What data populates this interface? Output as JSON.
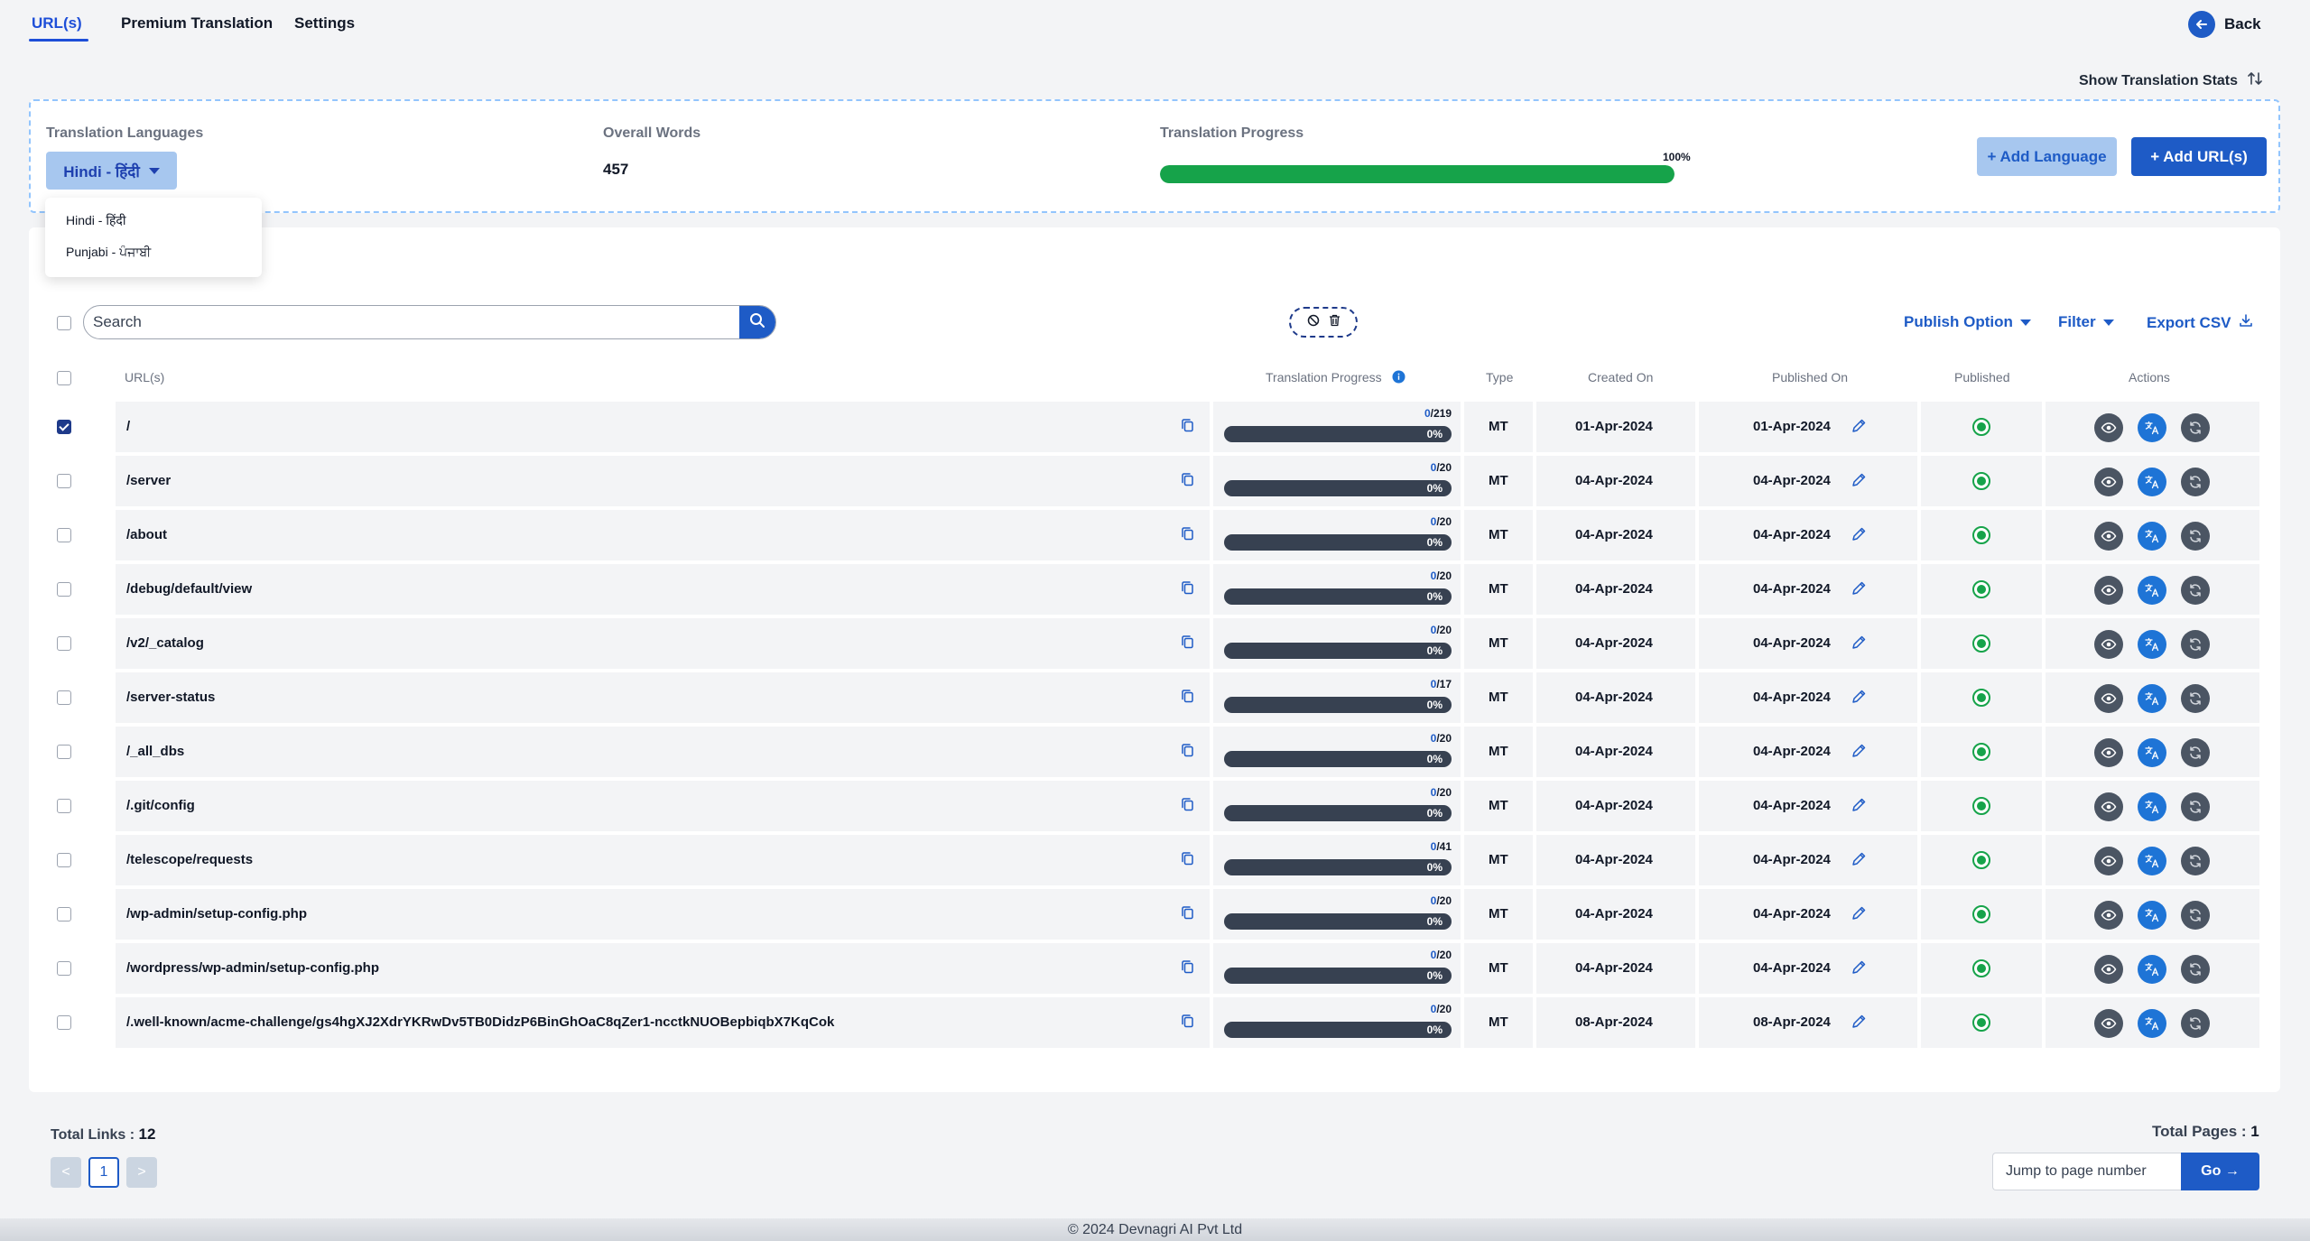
{
  "tabs": [
    {
      "label": "URL(s)"
    },
    {
      "label": "Premium Translation"
    },
    {
      "label": "Settings"
    }
  ],
  "back_label": "Back",
  "show_stats_label": "Show Translation Stats",
  "summary": {
    "languages_label": "Translation Languages",
    "selected_language": "Hindi - हिंदी",
    "overall_words_label": "Overall Words",
    "overall_words": "457",
    "progress_label": "Translation Progress",
    "progress_percent_text": "100%",
    "progress_value": 1.0,
    "add_language_label": "+ Add Language",
    "add_url_label": "+ Add URL(s)"
  },
  "language_options": [
    "Hindi - हिंदी",
    "Punjabi - ਪੰਜਾਬੀ"
  ],
  "search": {
    "placeholder": "Search"
  },
  "toolbar": {
    "publish_option": "Publish Option",
    "filter": "Filter",
    "export_csv": "Export CSV"
  },
  "table": {
    "headers": {
      "url": "URL(s)",
      "progress": "Translation Progress",
      "type": "Type",
      "created": "Created On",
      "published_on": "Published On",
      "published": "Published",
      "actions": "Actions"
    },
    "rows": [
      {
        "url": "/",
        "done": "0",
        "total": "/219",
        "pct": "0%",
        "type": "MT",
        "created": "01-Apr-2024",
        "published_on": "01-Apr-2024",
        "checked": true
      },
      {
        "url": "/server",
        "done": "0",
        "total": "/20",
        "pct": "0%",
        "type": "MT",
        "created": "04-Apr-2024",
        "published_on": "04-Apr-2024",
        "checked": false
      },
      {
        "url": "/about",
        "done": "0",
        "total": "/20",
        "pct": "0%",
        "type": "MT",
        "created": "04-Apr-2024",
        "published_on": "04-Apr-2024",
        "checked": false
      },
      {
        "url": "/debug/default/view",
        "done": "0",
        "total": "/20",
        "pct": "0%",
        "type": "MT",
        "created": "04-Apr-2024",
        "published_on": "04-Apr-2024",
        "checked": false
      },
      {
        "url": "/v2/_catalog",
        "done": "0",
        "total": "/20",
        "pct": "0%",
        "type": "MT",
        "created": "04-Apr-2024",
        "published_on": "04-Apr-2024",
        "checked": false
      },
      {
        "url": "/server-status",
        "done": "0",
        "total": "/17",
        "pct": "0%",
        "type": "MT",
        "created": "04-Apr-2024",
        "published_on": "04-Apr-2024",
        "checked": false
      },
      {
        "url": "/_all_dbs",
        "done": "0",
        "total": "/20",
        "pct": "0%",
        "type": "MT",
        "created": "04-Apr-2024",
        "published_on": "04-Apr-2024",
        "checked": false
      },
      {
        "url": "/.git/config",
        "done": "0",
        "total": "/20",
        "pct": "0%",
        "type": "MT",
        "created": "04-Apr-2024",
        "published_on": "04-Apr-2024",
        "checked": false
      },
      {
        "url": "/telescope/requests",
        "done": "0",
        "total": "/41",
        "pct": "0%",
        "type": "MT",
        "created": "04-Apr-2024",
        "published_on": "04-Apr-2024",
        "checked": false
      },
      {
        "url": "/wp-admin/setup-config.php",
        "done": "0",
        "total": "/20",
        "pct": "0%",
        "type": "MT",
        "created": "04-Apr-2024",
        "published_on": "04-Apr-2024",
        "checked": false
      },
      {
        "url": "/wordpress/wp-admin/setup-config.php",
        "done": "0",
        "total": "/20",
        "pct": "0%",
        "type": "MT",
        "created": "04-Apr-2024",
        "published_on": "04-Apr-2024",
        "checked": false
      },
      {
        "url": "/.well-known/acme-challenge/gs4hgXJ2XdrYKRwDv5TB0DidzP6BinGhOaC8qZer1-ncctkNUOBepbiqbX7KqCok",
        "done": "0",
        "total": "/20",
        "pct": "0%",
        "type": "MT",
        "created": "08-Apr-2024",
        "published_on": "08-Apr-2024",
        "checked": false
      }
    ]
  },
  "pagination": {
    "total_links_label": "Total Links : ",
    "total_links": "12",
    "prev": "<",
    "current": "1",
    "next": ">",
    "total_pages_label": "Total Pages : ",
    "total_pages": "1",
    "jump_placeholder": "Jump to page number",
    "go_label": "Go →"
  },
  "copyright": "© 2024 Devnagri AI Pvt Ltd",
  "colors": {
    "primary": "#1e5bc6",
    "success": "#16a34a",
    "light_blue": "#a7c7ef"
  }
}
